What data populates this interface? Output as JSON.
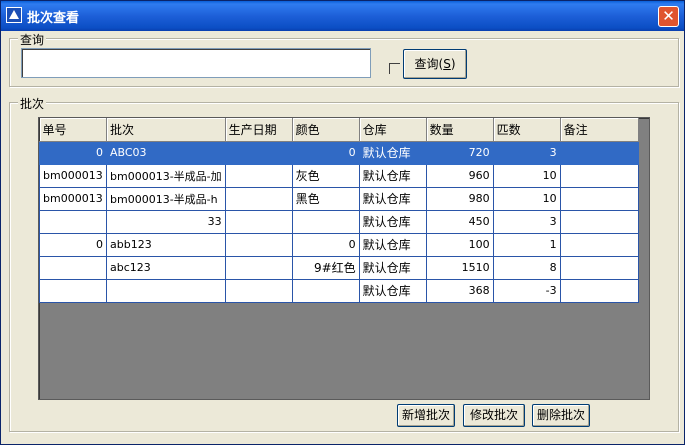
{
  "window": {
    "title": "批次查看",
    "close_label": "✕"
  },
  "query": {
    "group_label": "查询",
    "input_value": "",
    "button_label": "查询(",
    "button_hotkey": "S",
    "button_suffix": ")"
  },
  "batch": {
    "group_label": "批次",
    "columns": [
      "单号",
      "批次",
      "生产日期",
      "颜色",
      "仓库",
      "数量",
      "匹数",
      "备注"
    ],
    "rows": [
      [
        "0",
        "ABC03",
        "",
        "0",
        "默认仓库",
        "720",
        "3",
        ""
      ],
      [
        "bm000013",
        "bm000013-半成品-加",
        "",
        "灰色",
        "默认仓库",
        "960",
        "10",
        ""
      ],
      [
        "bm000013",
        "bm000013-半成品-h",
        "",
        "黑色",
        "默认仓库",
        "980",
        "10",
        ""
      ],
      [
        "",
        "33",
        "",
        "",
        "默认仓库",
        "450",
        "3",
        ""
      ],
      [
        "0",
        "abb123",
        "",
        "0",
        "默认仓库",
        "100",
        "1",
        ""
      ],
      [
        "",
        "abc123",
        "",
        "9#红色",
        "默认仓库",
        "1510",
        "8",
        ""
      ],
      [
        "",
        "",
        "",
        "",
        "默认仓库",
        "368",
        "-3",
        ""
      ]
    ]
  },
  "buttons": {
    "add": "新增批次",
    "edit": "修改批次",
    "delete": "删除批次"
  }
}
